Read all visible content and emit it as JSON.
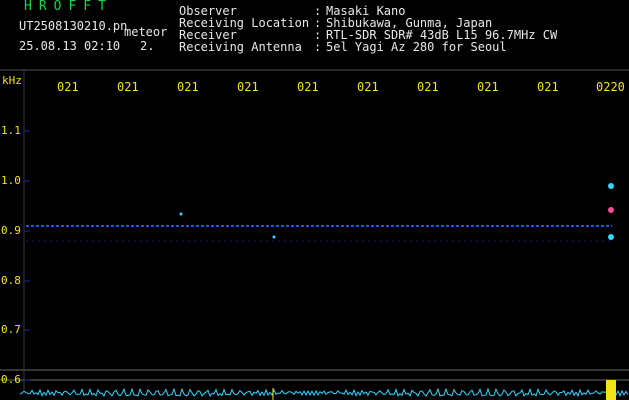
{
  "header": {
    "brand": "HROFFT",
    "file_name": "UT2508130210.pn",
    "file_suffix": "meteor",
    "date_time": "25.08.13 02:10",
    "counter": "2."
  },
  "metadata": [
    {
      "label": "Observer",
      "sep": ":",
      "value": "Masaki Kano"
    },
    {
      "label": "Receiving Location",
      "sep": ":",
      "value": "Shibukawa, Gunma, Japan"
    },
    {
      "label": "Receiver",
      "sep": ":",
      "value": "RTL-SDR SDR# 43dB L15 96.7MHz CW"
    },
    {
      "label": "Receiving Antenna",
      "sep": ":",
      "value": "5el Yagi Az 280 for Seoul"
    }
  ],
  "plot": {
    "unit_label": "kHz",
    "time_ticks": [
      "021",
      "021",
      "021",
      "021",
      "021",
      "021",
      "021",
      "021",
      "021",
      "0220"
    ],
    "freq_ticks": [
      "1.1",
      "1.0",
      "0.9",
      "0.8",
      "0.7",
      "0.6"
    ],
    "colors": {
      "grid": "#1a2a9c",
      "trace": "#2a5cff",
      "signal": "#35d4ff",
      "label": "#f2e21a",
      "text": "#19d24a"
    }
  }
}
